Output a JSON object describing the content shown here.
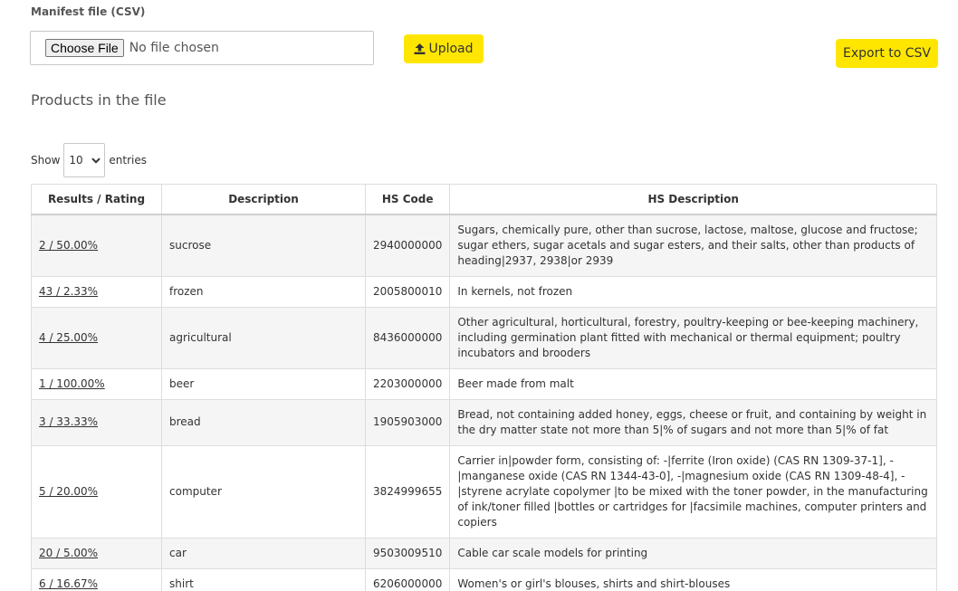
{
  "form": {
    "label": "Manifest file (CSV)",
    "choose_label": "Choose File",
    "no_file_text": "No file chosen",
    "upload_label": "Upload",
    "export_label": "Export to CSV"
  },
  "section": {
    "title": "Products in the file"
  },
  "entries": {
    "show_label": "Show",
    "selected": "10",
    "suffix": "entries"
  },
  "table": {
    "headers": [
      "Results / Rating",
      "Description",
      "HS Code",
      "HS Description"
    ],
    "rows": [
      {
        "rating": "2 / 50.00%",
        "description": "sucrose",
        "hs_code": "2940000000",
        "hs_description": "Sugars, chemically pure, other than sucrose, lactose, maltose, glucose and fructose; sugar ethers, sugar acetals and sugar esters, and their salts, other than products of heading|2937, 2938|or 2939"
      },
      {
        "rating": "43 / 2.33%",
        "description": "frozen",
        "hs_code": "2005800010",
        "hs_description": "In kernels, not frozen"
      },
      {
        "rating": "4 / 25.00%",
        "description": "agricultural",
        "hs_code": "8436000000",
        "hs_description": "Other agricultural, horticultural, forestry, poultry-keeping or bee-keeping machinery, including germination plant fitted with mechanical or thermal equipment; poultry incubators and brooders"
      },
      {
        "rating": "1 / 100.00%",
        "description": "beer",
        "hs_code": "2203000000",
        "hs_description": "Beer made from malt"
      },
      {
        "rating": "3 / 33.33%",
        "description": "bread",
        "hs_code": "1905903000",
        "hs_description": "Bread, not containing added honey, eggs, cheese or fruit, and containing by weight in the dry matter state not more than 5|% of sugars and not more than 5|% of fat"
      },
      {
        "rating": "5 / 20.00%",
        "description": "computer",
        "hs_code": "3824999655",
        "hs_description": "Carrier in|powder form, consisting of: -|ferrite (Iron oxide) (CAS RN 1309-37-1], -|manganese oxide (CAS RN 1344-43-0], -|magnesium oxide (CAS RN 1309-48-4], -|styrene acrylate copolymer |to be mixed with the toner powder, in the manufacturing of ink/toner filled |bottles or cartridges for |facsimile machines, computer printers and copiers"
      },
      {
        "rating": "20 / 5.00%",
        "description": "car",
        "hs_code": "9503009510",
        "hs_description": "Cable car scale models for printing"
      },
      {
        "rating": "6 / 16.67%",
        "description": "shirt",
        "hs_code": "6206000000",
        "hs_description": "Women's or girl's blouses, shirts and shirt-blouses"
      }
    ]
  },
  "colors": {
    "accent": "#ffe600",
    "row_stripe": "#f5f5f5",
    "border": "#dddddd"
  },
  "icons": {
    "upload": "upload-icon",
    "dropdown": "chevron-down-icon"
  }
}
